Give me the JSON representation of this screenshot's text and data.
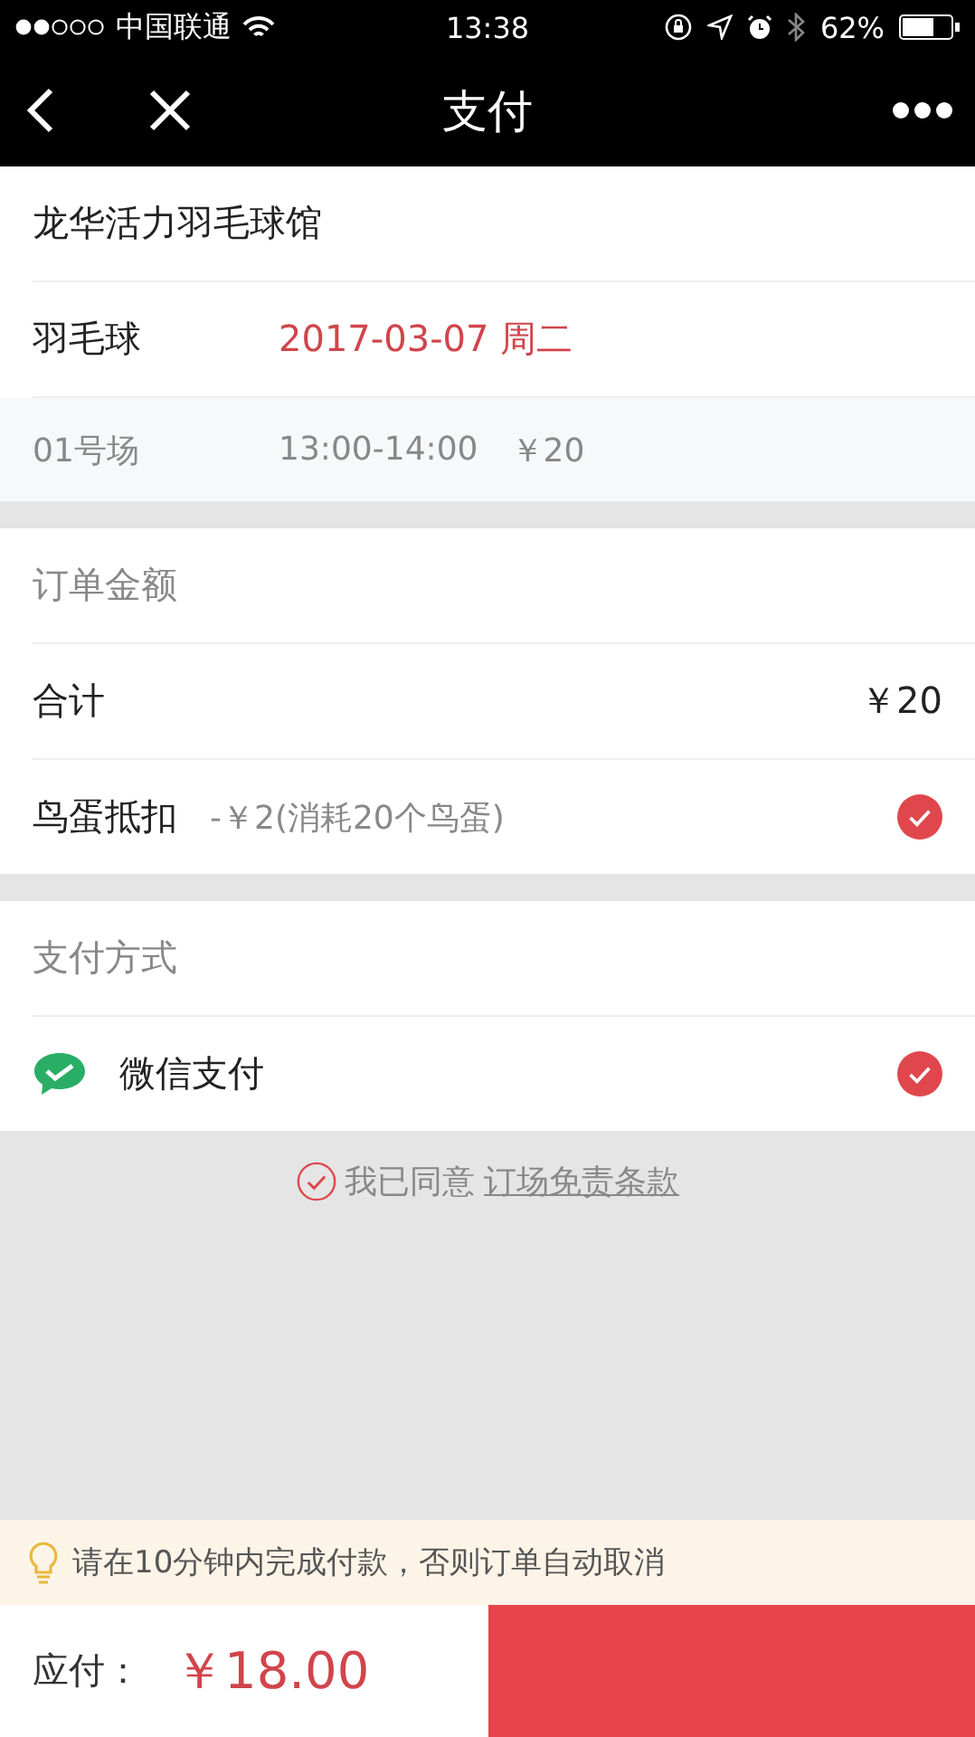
{
  "status_bar": {
    "carrier": "中国联通",
    "time": "13:38",
    "battery": "62%"
  },
  "nav": {
    "title": "支付"
  },
  "venue": {
    "name": "龙华活力羽毛球馆"
  },
  "booking": {
    "sport": "羽毛球",
    "date": "2017-03-07 周二",
    "court": "01号场",
    "time": "13:00-14:00",
    "price": "￥20"
  },
  "order": {
    "header": "订单金额",
    "rows": [
      {
        "kind": "total",
        "label": "合计",
        "value": "￥20"
      },
      {
        "kind": "discount",
        "label": "鸟蛋抵扣",
        "value": "-￥2(消耗20个鸟蛋)",
        "checked": true
      }
    ]
  },
  "payment": {
    "header": "支付方式",
    "methods": [
      {
        "label": "微信支付",
        "selected": true
      }
    ]
  },
  "agreement": {
    "checked": true,
    "text": "我已同意",
    "link": "订场免责条款"
  },
  "notice": "请在10分钟内完成付款，否则订单自动取消",
  "footer": {
    "label": "应付：",
    "amount": "￥18.00"
  }
}
